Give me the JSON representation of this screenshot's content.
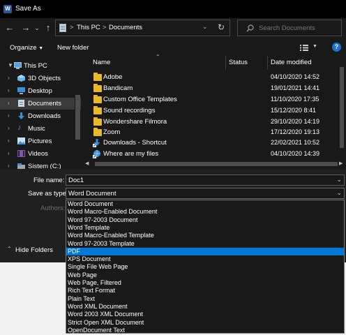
{
  "window": {
    "title": "Save As",
    "app_icon": "W"
  },
  "nav": {
    "back_icon": "back-arrow-icon",
    "forward_icon": "forward-arrow-icon",
    "recent_icon": "chevron-down-icon",
    "up_icon": "up-arrow-icon"
  },
  "address": {
    "crumbs": [
      "This PC",
      "Documents"
    ],
    "separator": ">",
    "refresh_icon": "refresh-icon"
  },
  "search": {
    "placeholder": "Search Documents"
  },
  "toolbar": {
    "organize": "Organize",
    "new_folder": "New folder",
    "view_icon": "view-icon",
    "help": "?"
  },
  "sidebar": {
    "items": [
      {
        "label": "This PC",
        "icon": "pc-icon"
      },
      {
        "label": "3D Objects",
        "icon": "cube-icon"
      },
      {
        "label": "Desktop",
        "icon": "desktop-icon"
      },
      {
        "label": "Documents",
        "icon": "document-icon",
        "selected": true
      },
      {
        "label": "Downloads",
        "icon": "download-icon"
      },
      {
        "label": "Music",
        "icon": "music-icon"
      },
      {
        "label": "Pictures",
        "icon": "picture-icon"
      },
      {
        "label": "Videos",
        "icon": "video-icon"
      },
      {
        "label": "Sistem (C:)",
        "icon": "drive-icon"
      }
    ]
  },
  "file_list": {
    "columns": {
      "name": "Name",
      "status": "Status",
      "date": "Date modified"
    },
    "rows": [
      {
        "name": "Adobe",
        "date": "04/10/2020 14:52",
        "type": "folder"
      },
      {
        "name": "Bandicam",
        "date": "19/01/2021 14:41",
        "type": "folder"
      },
      {
        "name": "Custom Office Templates",
        "date": "11/10/2020 17:35",
        "type": "folder"
      },
      {
        "name": "Sound recordings",
        "date": "15/12/2020 8:41",
        "type": "folder"
      },
      {
        "name": "Wondershare Filmora",
        "date": "29/10/2020 14:19",
        "type": "folder"
      },
      {
        "name": "Zoom",
        "date": "17/12/2020 19:13",
        "type": "folder"
      },
      {
        "name": "Downloads - Shortcut",
        "date": "22/02/2021 10:52",
        "type": "shortcut"
      },
      {
        "name": "Where are my files",
        "date": "04/10/2020 14:39",
        "type": "shortcut"
      }
    ]
  },
  "form": {
    "file_name_label": "File name:",
    "file_name_value": "Doc1",
    "save_type_label": "Save as type:",
    "save_type_value": "Word Document",
    "authors_label": "Authors:",
    "hide_folders": "Hide Folders"
  },
  "dropdown": {
    "options": [
      "Word Document",
      "Word Macro-Enabled Document",
      "Word 97-2003 Document",
      "Word Template",
      "Word Macro-Enabled Template",
      "Word 97-2003 Template",
      "PDF",
      "XPS Document",
      "Single File Web Page",
      "Web Page",
      "Web Page, Filtered",
      "Rich Text Format",
      "Plain Text",
      "Word XML Document",
      "Word 2003 XML Document",
      "Strict Open XML Document",
      "OpenDocument Text"
    ],
    "highlighted": "PDF"
  },
  "colors": {
    "accent": "#0078d7",
    "folder": "#e8b830",
    "background": "#191919"
  }
}
